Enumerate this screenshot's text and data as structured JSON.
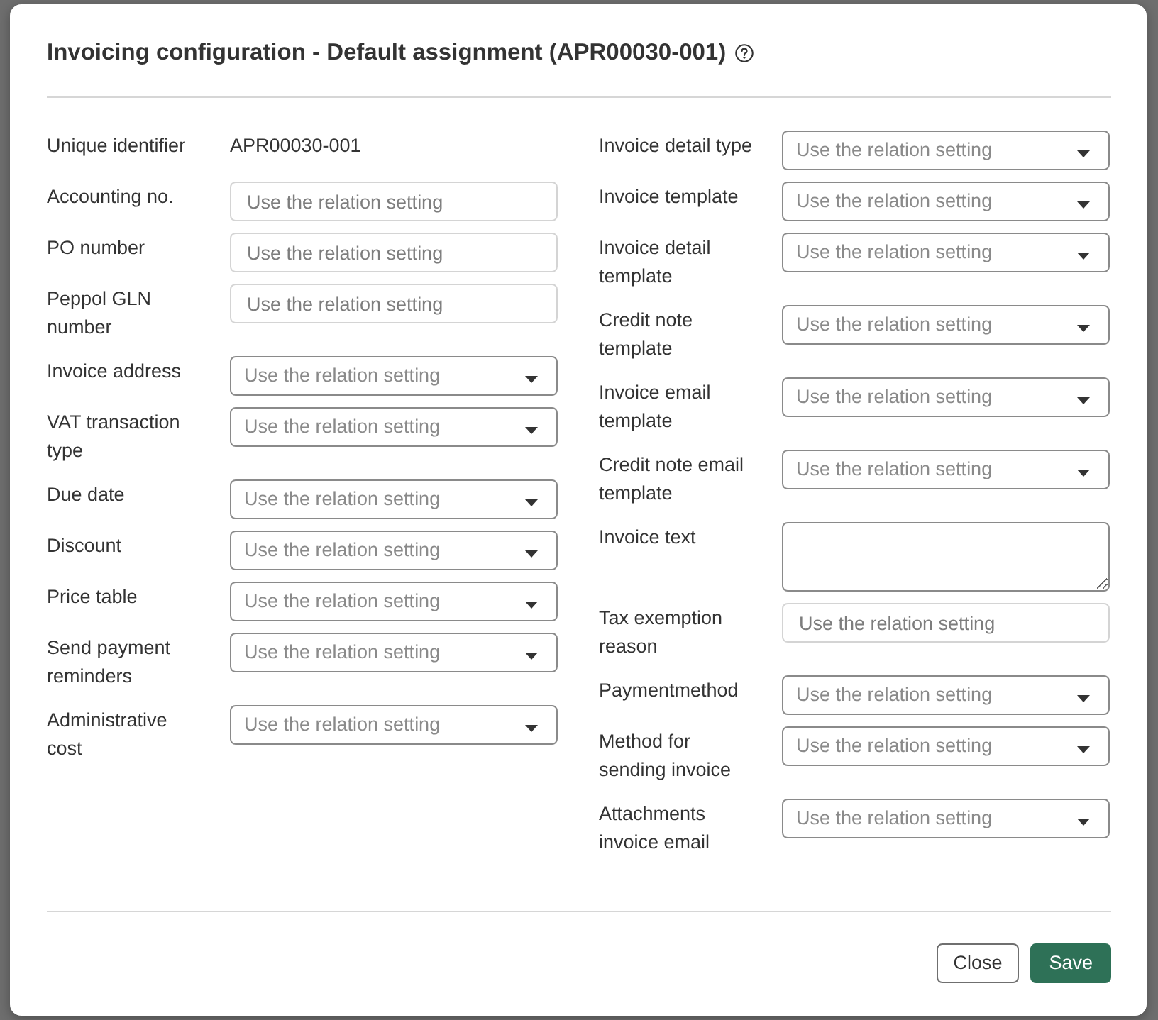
{
  "dialog": {
    "title": "Invoicing configuration - Default assignment (APR00030-001)"
  },
  "columns": [
    {
      "fields": [
        {
          "label": "Unique identifier",
          "kind": "text",
          "value": "APR00030-001"
        },
        {
          "label": "Accounting no.",
          "kind": "input",
          "placeholder": "Use the relation setting"
        },
        {
          "label": "PO number",
          "kind": "input",
          "placeholder": "Use the relation setting"
        },
        {
          "label": "Peppol GLN number",
          "kind": "input",
          "placeholder": "Use the relation setting"
        },
        {
          "label": "Invoice address",
          "kind": "select",
          "placeholder": "Use the relation setting"
        },
        {
          "label": "VAT transaction type",
          "kind": "select",
          "placeholder": "Use the relation setting"
        },
        {
          "label": "Due date",
          "kind": "select",
          "placeholder": "Use the relation setting"
        },
        {
          "label": "Discount",
          "kind": "select",
          "placeholder": "Use the relation setting"
        },
        {
          "label": "Price table",
          "kind": "select",
          "placeholder": "Use the relation setting"
        },
        {
          "label": "Send payment reminders",
          "kind": "select",
          "placeholder": "Use the relation setting"
        },
        {
          "label": "Administrative cost",
          "kind": "select",
          "placeholder": "Use the relation setting"
        }
      ]
    },
    {
      "fields": [
        {
          "label": "Invoice detail type",
          "kind": "select",
          "placeholder": "Use the relation setting"
        },
        {
          "label": "Invoice template",
          "kind": "select",
          "placeholder": "Use the relation setting"
        },
        {
          "label": "Invoice detail template",
          "kind": "select",
          "placeholder": "Use the relation setting"
        },
        {
          "label": "Credit note template",
          "kind": "select",
          "placeholder": "Use the relation setting"
        },
        {
          "label": "Invoice email template",
          "kind": "select",
          "placeholder": "Use the relation setting"
        },
        {
          "label": "Credit note email template",
          "kind": "select",
          "placeholder": "Use the relation setting"
        },
        {
          "label": "Invoice text",
          "kind": "textarea"
        },
        {
          "label": "Tax exemption reason",
          "kind": "input",
          "placeholder": "Use the relation setting"
        },
        {
          "label": "Paymentmethod",
          "kind": "select",
          "placeholder": "Use the relation setting"
        },
        {
          "label": "Method for sending invoice",
          "kind": "select",
          "placeholder": "Use the relation setting"
        },
        {
          "label": "Attachments invoice email",
          "kind": "select",
          "placeholder": "Use the relation setting"
        }
      ]
    }
  ],
  "buttons": [
    {
      "label": "Close",
      "kind": "secondary"
    },
    {
      "label": "Save",
      "kind": "primary"
    }
  ]
}
